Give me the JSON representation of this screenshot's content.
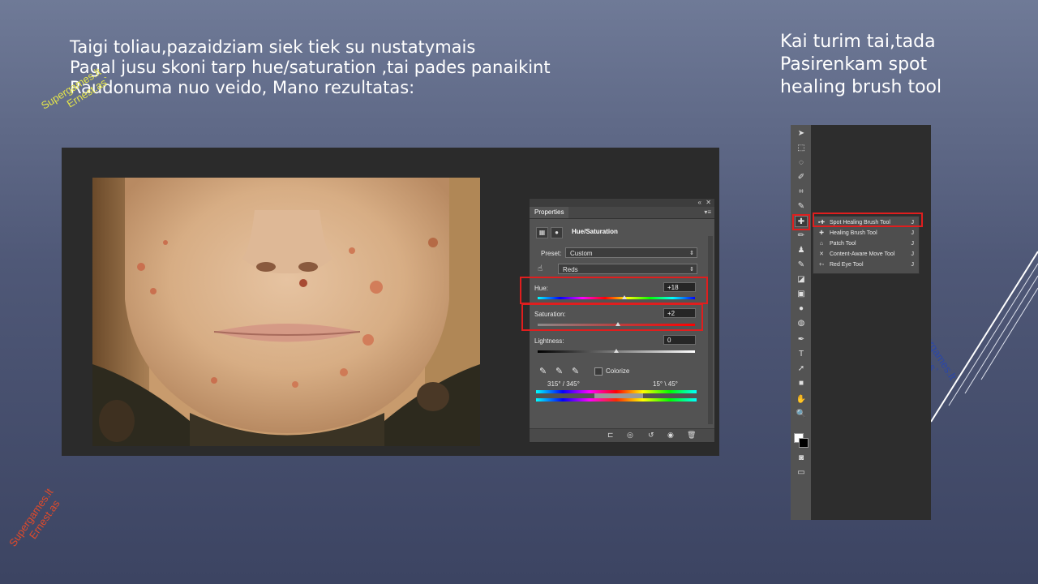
{
  "slide": {
    "intro_lines": [
      "Taigi toliau,pazaidziam siek tiek su nustatymais",
      "Pagal jusu skoni tarp hue/saturation ,tai pades panaikint",
      "Raudonuma nuo veido, Mano rezultatas:"
    ],
    "side_lines": [
      "Kai turim tai,tada",
      "Pasirenkam spot",
      "healing brush tool"
    ],
    "watermark_lines": [
      "Supergames.lt",
      "Ernest.as`"
    ],
    "watermark_lines_2": [
      "Supergames.lt",
      "Ernest.as"
    ]
  },
  "properties": {
    "tab_label": "Properties",
    "header_title": "Hue/Saturation",
    "preset_label": "Preset:",
    "preset_value": "Custom",
    "channel_value": "Reds",
    "hue_label": "Hue:",
    "hue_value": "+18",
    "saturation_label": "Saturation:",
    "saturation_value": "+2",
    "lightness_label": "Lightness:",
    "lightness_value": "0",
    "colorize_label": "Colorize",
    "range_left": "315° / 345°",
    "range_right": "15° \\ 45°",
    "levels": {
      "hue": 18,
      "saturation": 2,
      "lightness": 0
    }
  },
  "toolbar": {
    "flyout_items": [
      {
        "label": "Spot Healing Brush Tool",
        "key": "J",
        "icon": "spot-healing-icon",
        "selected": true
      },
      {
        "label": "Healing Brush Tool",
        "key": "J",
        "icon": "healing-brush-icon"
      },
      {
        "label": "Patch Tool",
        "key": "J",
        "icon": "patch-icon"
      },
      {
        "label": "Content-Aware Move Tool",
        "key": "J",
        "icon": "content-aware-move-icon"
      },
      {
        "label": "Red Eye Tool",
        "key": "J",
        "icon": "red-eye-icon"
      }
    ]
  },
  "colors": {
    "highlight": "#e01e1e",
    "ps_panel": "#535353",
    "ps_bg": "#2b2b2b"
  }
}
